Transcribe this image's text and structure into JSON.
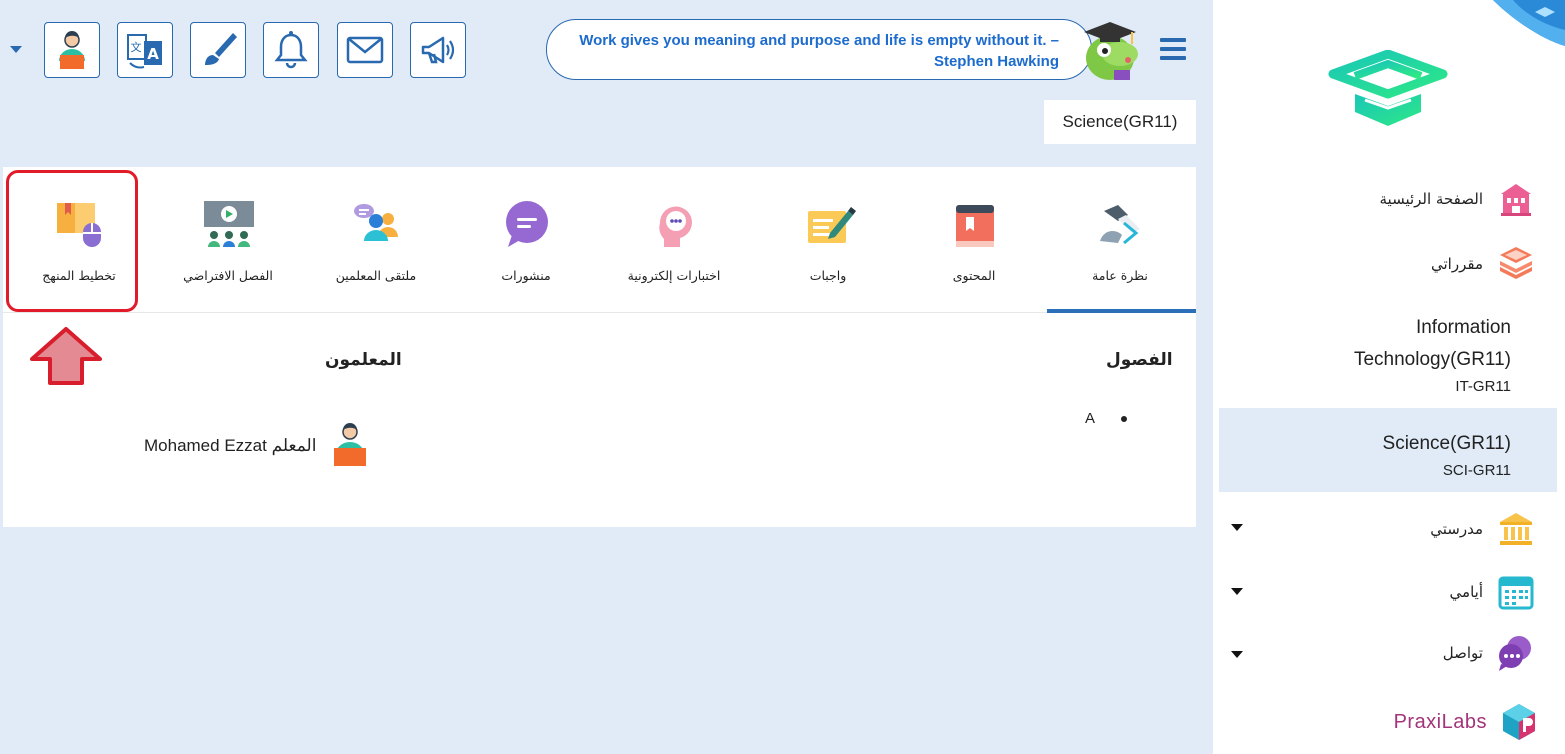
{
  "topbar": {
    "quote": "Work gives you meaning and purpose and life is empty without it. – Stephen Hawking",
    "buttons": [
      "profile-icon",
      "translate-icon",
      "brush-icon",
      "bell-icon",
      "mail-icon",
      "megaphone-icon"
    ],
    "accent": "#2869b0"
  },
  "course_selector": "Science(GR11)",
  "sidebar": {
    "items": [
      {
        "label": "الصفحة الرئيسية",
        "icon": "school-building-icon"
      },
      {
        "label": "مقرراتي",
        "icon": "books-stack-icon"
      },
      {
        "label": "مدرستي",
        "icon": "institution-icon"
      },
      {
        "label": "أيامي",
        "icon": "calendar-icon"
      },
      {
        "label": "تواصل",
        "icon": "chat-icon"
      }
    ],
    "courses": [
      {
        "name_line1": "Information",
        "name_line2": "Technology(GR11)",
        "code": "IT-GR11"
      },
      {
        "name": "Science(GR11)",
        "code": "SCI-GR11",
        "active": true
      }
    ],
    "footer_brand": "PraxiLabs"
  },
  "tabs": [
    {
      "label": "نظرة عامة",
      "icon": "overview-icon",
      "active": true
    },
    {
      "label": "المحتوى",
      "icon": "content-book-icon"
    },
    {
      "label": "واجبات",
      "icon": "assignments-icon"
    },
    {
      "label": "اختبارات إلكترونية",
      "icon": "e-quiz-icon"
    },
    {
      "label": "منشورات",
      "icon": "posts-icon"
    },
    {
      "label": "ملتقى المعلمين",
      "icon": "teachers-forum-icon"
    },
    {
      "label": "الفصل الافتراضي",
      "icon": "virtual-class-icon"
    },
    {
      "label": "تخطيط المنهج",
      "icon": "curriculum-planning-icon",
      "highlighted": true
    }
  ],
  "sections": {
    "classes_title": "الفصول",
    "classes": [
      "A"
    ],
    "teachers_title": "المعلمون",
    "teachers": [
      {
        "prefix": "المعلم",
        "name": "Mohamed Ezzat"
      }
    ]
  },
  "colors": {
    "highlight": "#e21b2a",
    "quote_text": "#1d6ccd",
    "active_tab": "#2a6fb8"
  }
}
